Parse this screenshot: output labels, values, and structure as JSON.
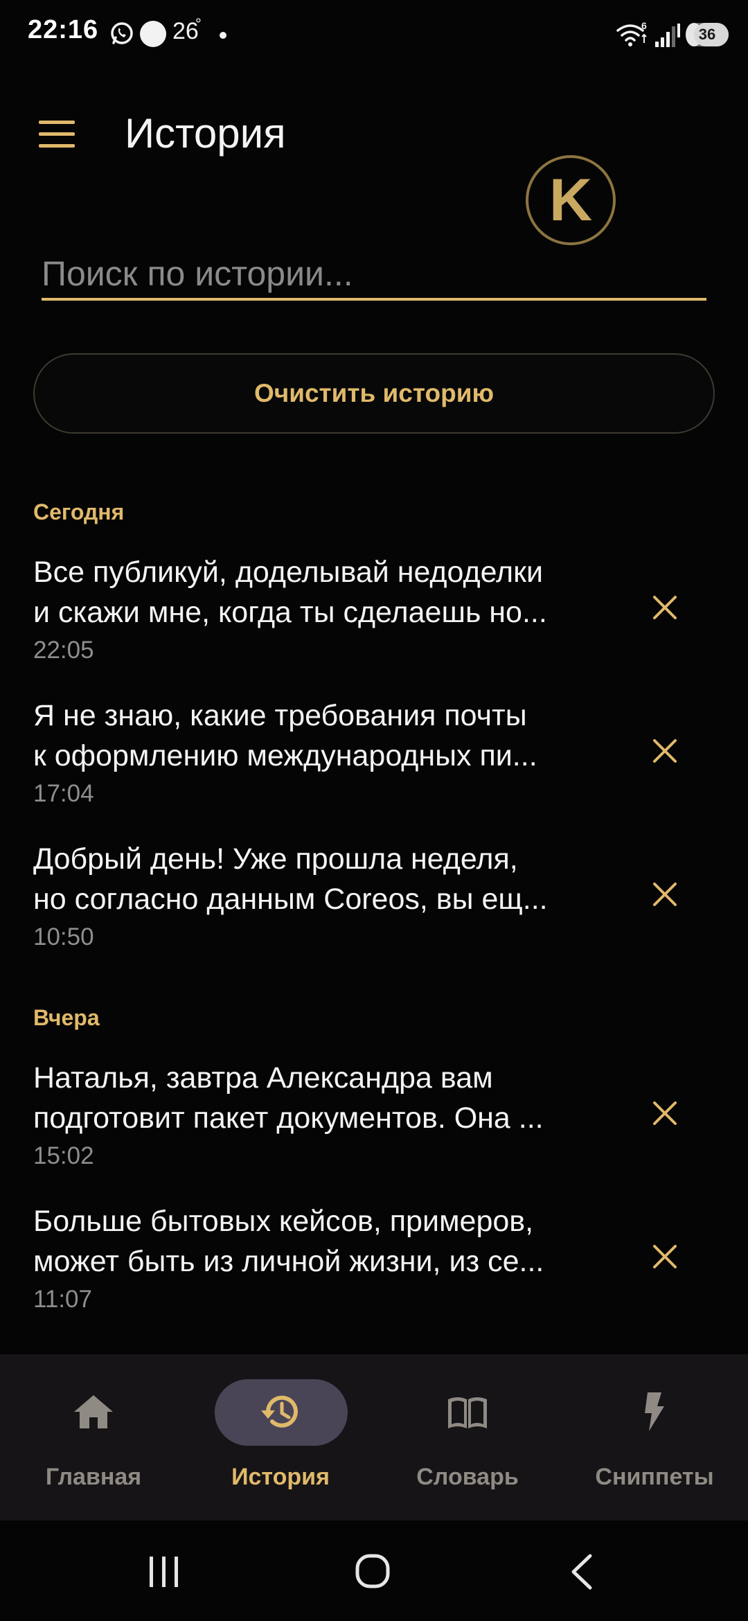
{
  "status_bar": {
    "time": "22:16",
    "temperature": "26",
    "degree": "°",
    "network": "6",
    "battery": "36"
  },
  "header": {
    "title": "История",
    "logo_letter": "K"
  },
  "search": {
    "placeholder": "Поиск по истории..."
  },
  "actions": {
    "clear_label": "Очистить историю"
  },
  "sections": [
    {
      "title": "Сегодня",
      "items": [
        {
          "line1": "Все публикуй, доделывай недоделки",
          "line2": "и скажи мне, когда ты сделаешь но...",
          "time": "22:05"
        },
        {
          "line1": "Я не знаю, какие требования почты",
          "line2": "к оформлению международных пи...",
          "time": "17:04"
        },
        {
          "line1": "Добрый день! Уже прошла неделя,",
          "line2": "но согласно данным Coreos, вы ещ...",
          "time": "10:50"
        }
      ]
    },
    {
      "title": "Вчера",
      "items": [
        {
          "line1": "Наталья, завтра Александра вам",
          "line2": "подготовит пакет документов. Она ...",
          "time": "15:02"
        },
        {
          "line1": "Больше бытовых кейсов, примеров,",
          "line2": "может быть из личной жизни, из се...",
          "time": "11:07"
        }
      ]
    }
  ],
  "bottom_nav": {
    "items": [
      {
        "label": "Главная",
        "icon": "home-icon",
        "active": false
      },
      {
        "label": "История",
        "icon": "history-icon",
        "active": true
      },
      {
        "label": "Словарь",
        "icon": "book-icon",
        "active": false
      },
      {
        "label": "Сниппеты",
        "icon": "bolt-icon",
        "active": false
      }
    ]
  },
  "colors": {
    "background": "#050505",
    "accent": "#e0b96b",
    "nav_background": "#161416",
    "nav_active_pill": "#4a4556",
    "muted_text": "#8e8e8e"
  }
}
